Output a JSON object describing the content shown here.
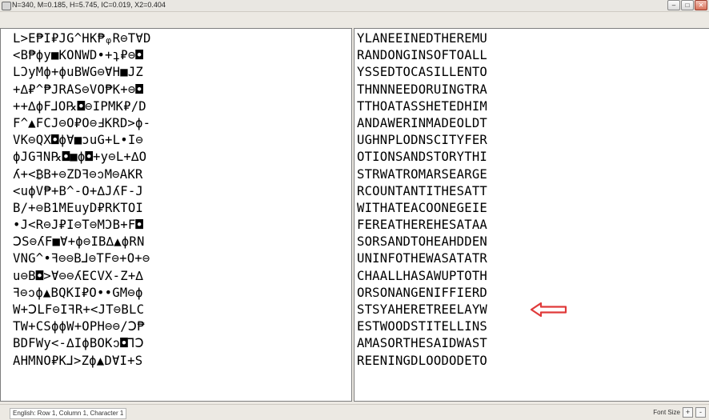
{
  "window": {
    "title": "N=340, M=0.185, H=5.745, IC=0.019, X2=0.404",
    "minimize_label": "–",
    "maximize_label": "□",
    "close_label": "✕"
  },
  "left_pane": {
    "lines": [
      "L>E₱I₽ЈG^HK₱ᵩR⊖T∀D",
      "<B₱ϕy■KONWD•+ʇ₽⊖◘",
      "LϽyMϕ+ϕuBWG⊖ⱯH■JZ",
      "+∆₽^₱JRAS⊖VO₱K+⊖◘",
      "++∆ϕF⅃O℞◘⊖IPMK₽/D",
      "F^▲FCЈ⊖O₽O⊖ℲKRD>ϕ-",
      "VK⊖QX◘ϕⱯ■ɔuG+L•I⊖",
      "ϕJGꟻN℞◘■ϕ◘+y⊖L+∆O",
      "ʎ+<₿B+⊖ZDꟻ⊖ↄM⊖AKR",
      "<uϕV₱+B^-O+∆ЈʎF-Ј",
      "B/+⊖B1MEuyD₽RKTOI",
      "•Ј<R⊖J₽I⊖T⊖MƆB+F◘",
      "ↃS⊖ʎF■Ɐ+ϕ⊖IB∆▲ϕRN",
      "VNG^•ꟻ⊖⊖B⅃⊖TF⊖+O+⊖",
      "u⊖B◘>Ɐ⊖⊖ʎECVX-Z+∆",
      "ꟻ⊖ↄϕ▲BQKI₽O••GM⊖ϕ",
      "W+ↃLF⊖IꟻR+<ЈT⊖BLC",
      "TW+CSϕϕW+OPH⊖⊖/Ↄ₱",
      "BDFWy<-∆IϕBOKↄ◘⅂Ↄ",
      "AHMNO₽K⅃>Zϕ▲DⱯI+S"
    ]
  },
  "right_pane": {
    "lines": [
      "YLANEEINEDTHEREMU",
      "RANDONGINSOFTOALL",
      "YSSEDTOCASILLENTO",
      "THNNNEEDORUINGTRA",
      "TTHOATASSHETEDHIM",
      "ANDAWERINMADEOLDT",
      "UGHNPLODNSCITYFER",
      "OTIONSANDSTORYTHI",
      "STRWATROMARSEARGE",
      "RCOUNTANTITHESATT",
      "WITHATEACOONEGEIE",
      "FEREATHEREHESATAA",
      "SORSANDTOHEAHDDEN",
      "UNINFOTHEWASATATR",
      "CHAALLHASAWUPTOTH",
      "ORSONANGENIFFIERD",
      "STSYAHERETREELAYW",
      "ESTWOODSTITELLINS",
      "AMASORTHESAIDWAST",
      "REENINGDLOODODETO"
    ]
  },
  "status": {
    "left_text": "English: Row 1, Column 1, Character 1",
    "font_size_label": "Font Size",
    "increase_label": "+",
    "decrease_label": "-"
  },
  "annotation": {
    "arrow_color": "#e03a3a",
    "icon": "left-arrow-icon"
  }
}
